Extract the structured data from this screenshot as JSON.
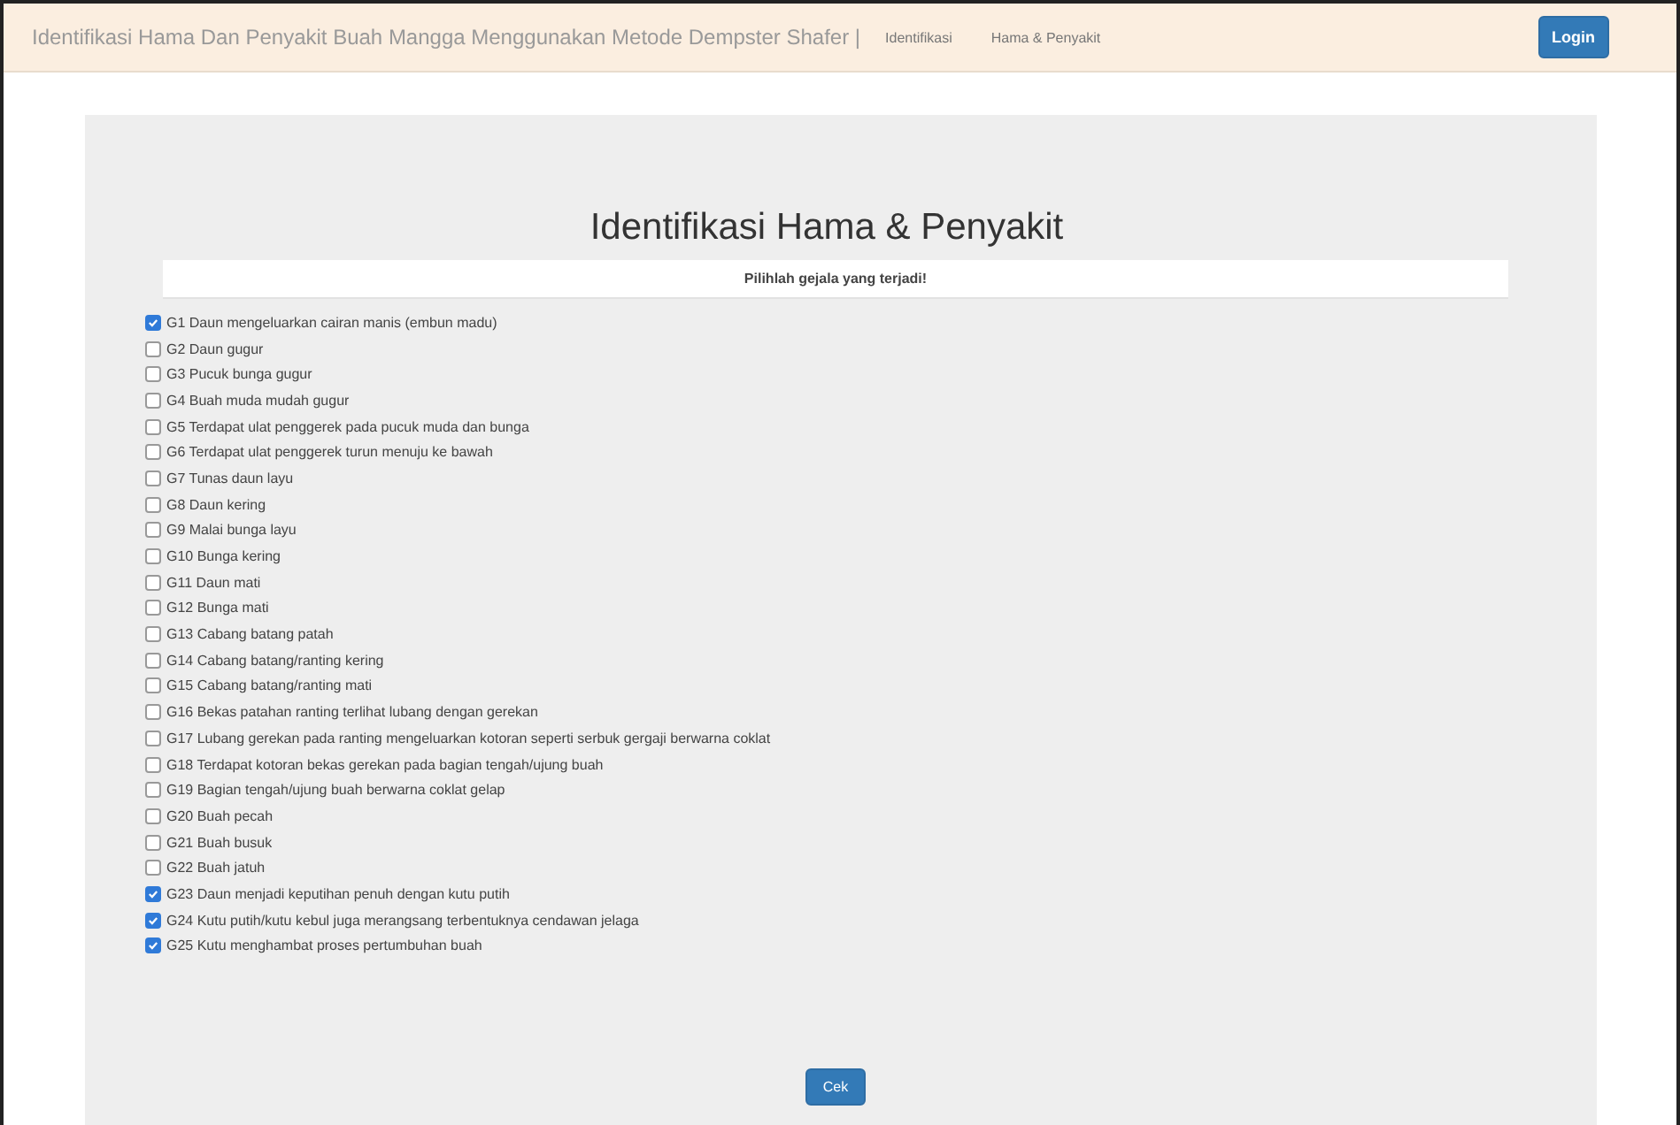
{
  "navbar": {
    "brand": "Identifikasi Hama Dan Penyakit Buah Mangga Menggunakan Metode Dempster Shafer |",
    "links": [
      "Identifikasi",
      "Hama & Penyakit"
    ],
    "login": "Login"
  },
  "page": {
    "title": "Identifikasi Hama & Penyakit",
    "table_header": "Pilihlah gejala yang terjadi!",
    "symptoms": [
      {
        "label": "G1 Daun mengeluarkan cairan manis (embun madu)",
        "checked": true
      },
      {
        "label": "G2 Daun gugur",
        "checked": false
      },
      {
        "label": "G3 Pucuk bunga gugur",
        "checked": false
      },
      {
        "label": "G4 Buah muda mudah gugur",
        "checked": false
      },
      {
        "label": "G5 Terdapat ulat penggerek pada pucuk muda dan bunga",
        "checked": false
      },
      {
        "label": "G6 Terdapat ulat penggerek turun menuju ke bawah",
        "checked": false
      },
      {
        "label": "G7 Tunas daun layu",
        "checked": false
      },
      {
        "label": "G8 Daun kering",
        "checked": false
      },
      {
        "label": "G9 Malai bunga layu",
        "checked": false
      },
      {
        "label": "G10 Bunga kering",
        "checked": false
      },
      {
        "label": "G11 Daun mati",
        "checked": false
      },
      {
        "label": "G12 Bunga mati",
        "checked": false
      },
      {
        "label": "G13 Cabang batang patah",
        "checked": false
      },
      {
        "label": "G14 Cabang batang/ranting kering",
        "checked": false
      },
      {
        "label": "G15 Cabang batang/ranting mati",
        "checked": false
      },
      {
        "label": "G16 Bekas patahan ranting terlihat lubang dengan gerekan",
        "checked": false
      },
      {
        "label": "G17 Lubang gerekan pada ranting mengeluarkan kotoran seperti serbuk gergaji berwarna coklat",
        "checked": false
      },
      {
        "label": "G18 Terdapat kotoran bekas gerekan pada bagian tengah/ujung buah",
        "checked": false
      },
      {
        "label": "G19 Bagian tengah/ujung buah berwarna coklat gelap",
        "checked": false
      },
      {
        "label": "G20 Buah pecah",
        "checked": false
      },
      {
        "label": "G21 Buah busuk",
        "checked": false
      },
      {
        "label": "G22 Buah jatuh",
        "checked": false
      },
      {
        "label": "G23 Daun menjadi keputihan penuh dengan kutu putih",
        "checked": true
      },
      {
        "label": "G24 Kutu putih/kutu kebul juga merangsang terbentuknya cendawan jelaga",
        "checked": true
      },
      {
        "label": "G25 Kutu menghambat proses pertumbuhan buah",
        "checked": true
      }
    ],
    "submit": "Cek"
  }
}
